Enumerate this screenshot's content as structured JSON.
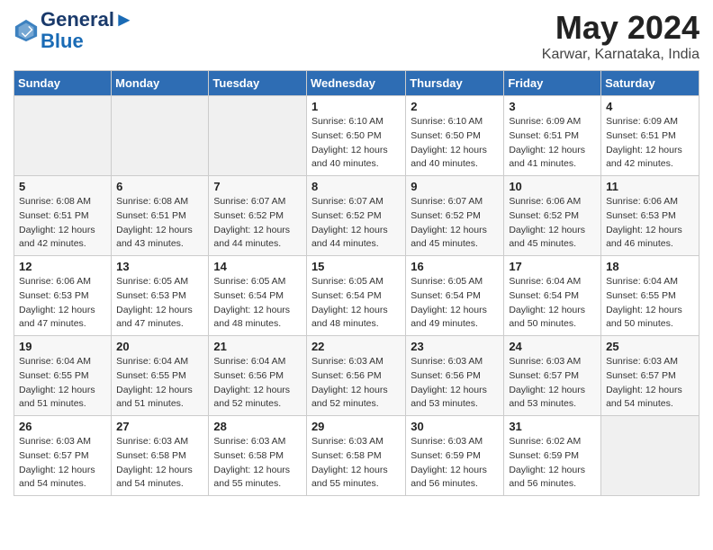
{
  "header": {
    "logo_line1": "General",
    "logo_line2": "Blue",
    "month_year": "May 2024",
    "location": "Karwar, Karnataka, India"
  },
  "weekdays": [
    "Sunday",
    "Monday",
    "Tuesday",
    "Wednesday",
    "Thursday",
    "Friday",
    "Saturday"
  ],
  "weeks": [
    [
      {
        "day": "",
        "info": ""
      },
      {
        "day": "",
        "info": ""
      },
      {
        "day": "",
        "info": ""
      },
      {
        "day": "1",
        "info": "Sunrise: 6:10 AM\nSunset: 6:50 PM\nDaylight: 12 hours\nand 40 minutes."
      },
      {
        "day": "2",
        "info": "Sunrise: 6:10 AM\nSunset: 6:50 PM\nDaylight: 12 hours\nand 40 minutes."
      },
      {
        "day": "3",
        "info": "Sunrise: 6:09 AM\nSunset: 6:51 PM\nDaylight: 12 hours\nand 41 minutes."
      },
      {
        "day": "4",
        "info": "Sunrise: 6:09 AM\nSunset: 6:51 PM\nDaylight: 12 hours\nand 42 minutes."
      }
    ],
    [
      {
        "day": "5",
        "info": "Sunrise: 6:08 AM\nSunset: 6:51 PM\nDaylight: 12 hours\nand 42 minutes."
      },
      {
        "day": "6",
        "info": "Sunrise: 6:08 AM\nSunset: 6:51 PM\nDaylight: 12 hours\nand 43 minutes."
      },
      {
        "day": "7",
        "info": "Sunrise: 6:07 AM\nSunset: 6:52 PM\nDaylight: 12 hours\nand 44 minutes."
      },
      {
        "day": "8",
        "info": "Sunrise: 6:07 AM\nSunset: 6:52 PM\nDaylight: 12 hours\nand 44 minutes."
      },
      {
        "day": "9",
        "info": "Sunrise: 6:07 AM\nSunset: 6:52 PM\nDaylight: 12 hours\nand 45 minutes."
      },
      {
        "day": "10",
        "info": "Sunrise: 6:06 AM\nSunset: 6:52 PM\nDaylight: 12 hours\nand 45 minutes."
      },
      {
        "day": "11",
        "info": "Sunrise: 6:06 AM\nSunset: 6:53 PM\nDaylight: 12 hours\nand 46 minutes."
      }
    ],
    [
      {
        "day": "12",
        "info": "Sunrise: 6:06 AM\nSunset: 6:53 PM\nDaylight: 12 hours\nand 47 minutes."
      },
      {
        "day": "13",
        "info": "Sunrise: 6:05 AM\nSunset: 6:53 PM\nDaylight: 12 hours\nand 47 minutes."
      },
      {
        "day": "14",
        "info": "Sunrise: 6:05 AM\nSunset: 6:54 PM\nDaylight: 12 hours\nand 48 minutes."
      },
      {
        "day": "15",
        "info": "Sunrise: 6:05 AM\nSunset: 6:54 PM\nDaylight: 12 hours\nand 48 minutes."
      },
      {
        "day": "16",
        "info": "Sunrise: 6:05 AM\nSunset: 6:54 PM\nDaylight: 12 hours\nand 49 minutes."
      },
      {
        "day": "17",
        "info": "Sunrise: 6:04 AM\nSunset: 6:54 PM\nDaylight: 12 hours\nand 50 minutes."
      },
      {
        "day": "18",
        "info": "Sunrise: 6:04 AM\nSunset: 6:55 PM\nDaylight: 12 hours\nand 50 minutes."
      }
    ],
    [
      {
        "day": "19",
        "info": "Sunrise: 6:04 AM\nSunset: 6:55 PM\nDaylight: 12 hours\nand 51 minutes."
      },
      {
        "day": "20",
        "info": "Sunrise: 6:04 AM\nSunset: 6:55 PM\nDaylight: 12 hours\nand 51 minutes."
      },
      {
        "day": "21",
        "info": "Sunrise: 6:04 AM\nSunset: 6:56 PM\nDaylight: 12 hours\nand 52 minutes."
      },
      {
        "day": "22",
        "info": "Sunrise: 6:03 AM\nSunset: 6:56 PM\nDaylight: 12 hours\nand 52 minutes."
      },
      {
        "day": "23",
        "info": "Sunrise: 6:03 AM\nSunset: 6:56 PM\nDaylight: 12 hours\nand 53 minutes."
      },
      {
        "day": "24",
        "info": "Sunrise: 6:03 AM\nSunset: 6:57 PM\nDaylight: 12 hours\nand 53 minutes."
      },
      {
        "day": "25",
        "info": "Sunrise: 6:03 AM\nSunset: 6:57 PM\nDaylight: 12 hours\nand 54 minutes."
      }
    ],
    [
      {
        "day": "26",
        "info": "Sunrise: 6:03 AM\nSunset: 6:57 PM\nDaylight: 12 hours\nand 54 minutes."
      },
      {
        "day": "27",
        "info": "Sunrise: 6:03 AM\nSunset: 6:58 PM\nDaylight: 12 hours\nand 54 minutes."
      },
      {
        "day": "28",
        "info": "Sunrise: 6:03 AM\nSunset: 6:58 PM\nDaylight: 12 hours\nand 55 minutes."
      },
      {
        "day": "29",
        "info": "Sunrise: 6:03 AM\nSunset: 6:58 PM\nDaylight: 12 hours\nand 55 minutes."
      },
      {
        "day": "30",
        "info": "Sunrise: 6:03 AM\nSunset: 6:59 PM\nDaylight: 12 hours\nand 56 minutes."
      },
      {
        "day": "31",
        "info": "Sunrise: 6:02 AM\nSunset: 6:59 PM\nDaylight: 12 hours\nand 56 minutes."
      },
      {
        "day": "",
        "info": ""
      }
    ]
  ]
}
